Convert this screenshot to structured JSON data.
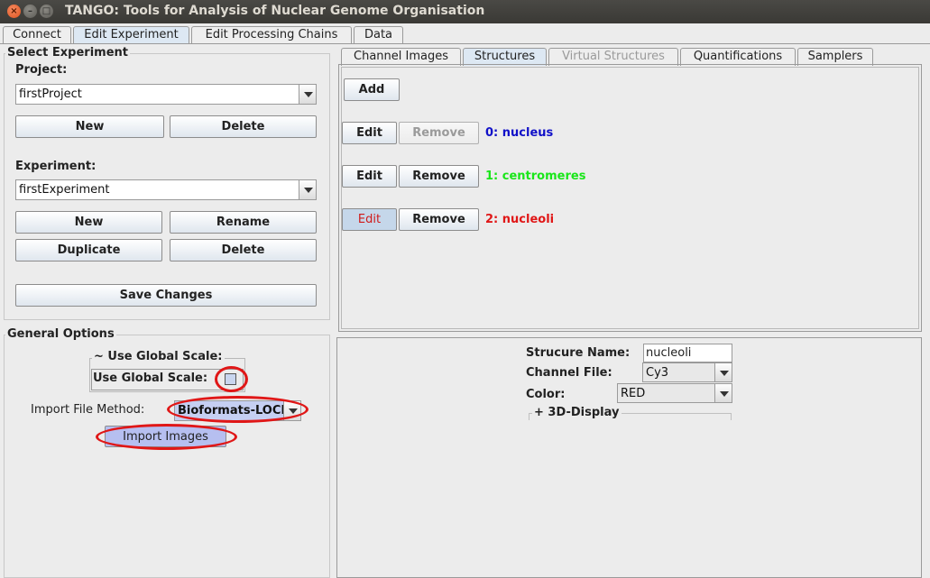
{
  "window": {
    "title": "TANGO: Tools for Analysis of Nuclear Genome Organisation"
  },
  "main_tabs": [
    "Connect",
    "Edit Experiment",
    "Edit Processing Chains",
    "Data"
  ],
  "select_experiment": {
    "title": "Select Experiment",
    "project_label": "Project:",
    "project_value": "firstProject",
    "new_label": "New",
    "delete_label": "Delete",
    "experiment_label": "Experiment:",
    "experiment_value": "firstExperiment",
    "exp_new_label": "New",
    "rename_label": "Rename",
    "duplicate_label": "Duplicate",
    "exp_delete_label": "Delete",
    "save_label": "Save Changes"
  },
  "general_options": {
    "title": "General Options",
    "scale_group_title": "~ Use Global Scale:",
    "scale_label": "Use Global Scale:",
    "scale_checked": false,
    "import_method_label": "Import File Method:",
    "import_method_value": "Bioformats-LOCI",
    "import_button": "Import Images"
  },
  "sub_tabs": [
    "Channel Images",
    "Structures",
    "Virtual Structures",
    "Quantifications",
    "Samplers"
  ],
  "structures": {
    "add_label": "Add",
    "edit_label": "Edit",
    "remove_label": "Remove",
    "items": [
      {
        "label": "0: nucleus",
        "color": "#1010c8"
      },
      {
        "label": "1: centromeres",
        "color": "#19e619"
      },
      {
        "label": "2: nucleoli",
        "color": "#e01717"
      }
    ]
  },
  "details": {
    "name_label": "Strucure Name:",
    "name_value": "nucleoli",
    "channel_label": "Channel File:",
    "channel_value": "Cy3",
    "color_label": "Color:",
    "color_value": "RED",
    "display_label": "+ 3D-Display"
  }
}
